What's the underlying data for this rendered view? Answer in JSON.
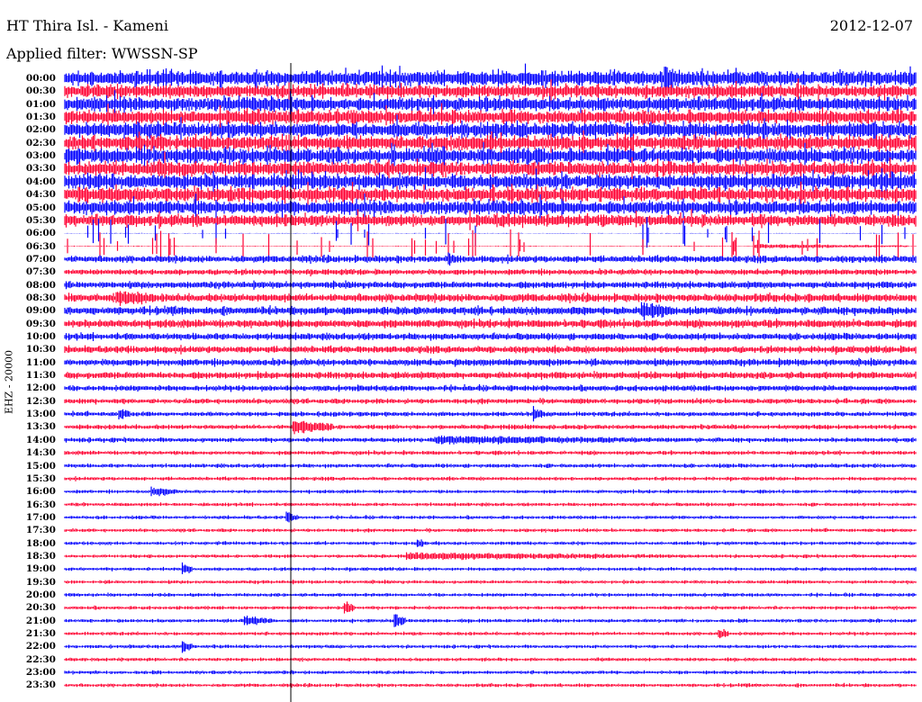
{
  "header": {
    "station": "HT Thira Isl. - Kameni",
    "date": "2012-12-07",
    "filter": "Applied filter: WWSSN-SP"
  },
  "chart_data": {
    "type": "line",
    "title": "HT Thira Isl. - Kameni",
    "ylabel": "EHZ - 20000",
    "xlabel": "",
    "minutes_per_line": 30,
    "colors": [
      "#0000ff",
      "#ff0033"
    ],
    "tick_labels": [
      "00:00",
      "00:30",
      "01:00",
      "01:30",
      "02:00",
      "02:30",
      "03:00",
      "03:30",
      "04:00",
      "04:30",
      "05:00",
      "05:30",
      "06:00",
      "06:30",
      "07:00",
      "07:30",
      "08:00",
      "08:30",
      "09:00",
      "09:30",
      "10:00",
      "10:30",
      "11:00",
      "11:30",
      "12:00",
      "12:30",
      "13:00",
      "13:30",
      "14:00",
      "14:30",
      "15:00",
      "15:30",
      "16:00",
      "16:30",
      "17:00",
      "17:30",
      "18:00",
      "18:30",
      "19:00",
      "19:30",
      "20:00",
      "20:30",
      "21:00",
      "21:30",
      "22:00",
      "22:30",
      "23:00",
      "23:30"
    ],
    "noise_amplitude": [
      13,
      11,
      12,
      12,
      13,
      12,
      13,
      12,
      13,
      12,
      12,
      10,
      0.5,
      0.8,
      6,
      5,
      6,
      7,
      7,
      7,
      6,
      6,
      6,
      6,
      5,
      4.5,
      4,
      4,
      4,
      3.5,
      3.5,
      3.2,
      3,
      3,
      3,
      3,
      3,
      3,
      3,
      3,
      3,
      3,
      3,
      3,
      3,
      3,
      3,
      3
    ],
    "events": [
      {
        "line": 0,
        "minute": 21.1,
        "amplitude": 22
      },
      {
        "line": 13,
        "minute": 24.3,
        "amplitude": 3,
        "duration": 5.4
      },
      {
        "line": 14,
        "minute": 13.5,
        "amplitude": 9
      },
      {
        "line": 17,
        "minute": 1.8,
        "amplitude": 12,
        "duration": 1.5
      },
      {
        "line": 18,
        "minute": 20.3,
        "amplitude": 12,
        "duration": 1.2
      },
      {
        "line": 26,
        "minute": 1.9,
        "amplitude": 8
      },
      {
        "line": 26,
        "minute": 16.5,
        "amplitude": 10
      },
      {
        "line": 27,
        "minute": 8.0,
        "amplitude": 10,
        "duration": 1.5
      },
      {
        "line": 28,
        "minute": 13.0,
        "amplitude": 6,
        "duration": 9
      },
      {
        "line": 32,
        "minute": 3.0,
        "amplitude": 7,
        "duration": 1
      },
      {
        "line": 34,
        "minute": 7.8,
        "amplitude": 8
      },
      {
        "line": 36,
        "minute": 12.4,
        "amplitude": 6
      },
      {
        "line": 37,
        "minute": 12.0,
        "amplitude": 5,
        "duration": 10
      },
      {
        "line": 38,
        "minute": 4.1,
        "amplitude": 9
      },
      {
        "line": 41,
        "minute": 9.8,
        "amplitude": 10
      },
      {
        "line": 42,
        "minute": 6.3,
        "amplitude": 7,
        "duration": 1
      },
      {
        "line": 42,
        "minute": 11.6,
        "amplitude": 11
      },
      {
        "line": 43,
        "minute": 23.0,
        "amplitude": 8
      },
      {
        "line": 44,
        "minute": 4.1,
        "amplitude": 9
      }
    ]
  }
}
